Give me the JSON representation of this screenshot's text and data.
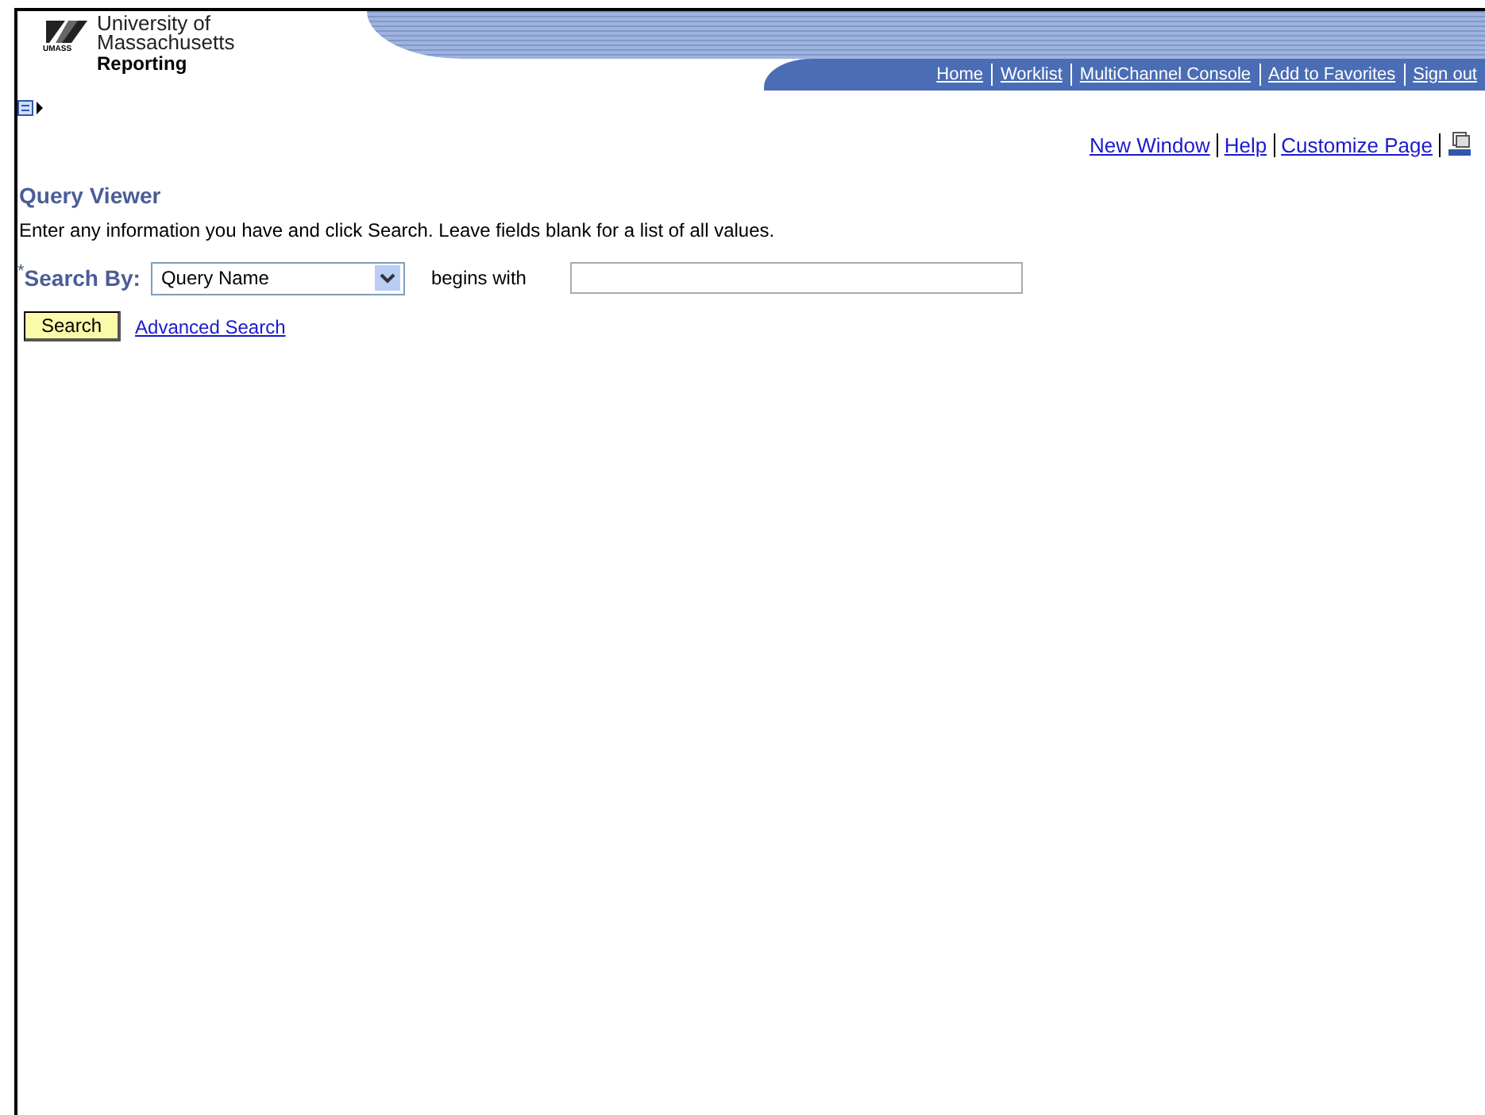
{
  "header": {
    "logo_lines": [
      "University of",
      "Massachusetts"
    ],
    "logo_mark": "UMASS",
    "subtitle": "Reporting",
    "nav": [
      "Home",
      "Worklist",
      "MultiChannel Console",
      "Add to Favorites",
      "Sign out"
    ]
  },
  "page_links": [
    "New Window",
    "Help",
    "Customize Page"
  ],
  "title": "Query Viewer",
  "instructions": "Enter any information you have and click Search. Leave fields blank for a list of all values.",
  "search": {
    "required_mark": "*",
    "label": "Search By:",
    "select_value": "Query Name",
    "operator": "begins with"
  },
  "buttons": {
    "search": "Search",
    "advanced": "Advanced Search"
  }
}
